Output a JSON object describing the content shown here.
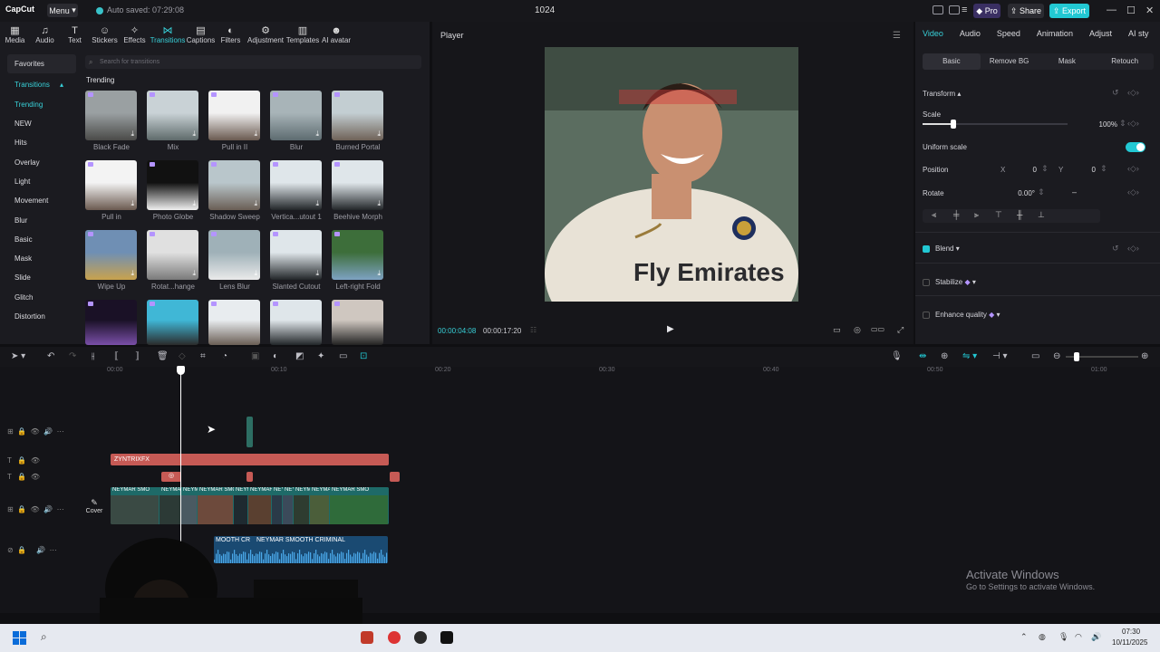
{
  "titlebar": {
    "logo": "CapCut",
    "menu_label": "Menu",
    "autosave": "Auto saved: 07:29:08",
    "project_name": "1024",
    "pro_label": "Pro",
    "share_label": "Share",
    "export_label": "Export",
    "colors": {
      "pro": "#3a2f62",
      "share": "#2b2b31",
      "export": "#22c8d3"
    }
  },
  "toolbar": {
    "tools": [
      {
        "label": "Media",
        "icon": "media-icon"
      },
      {
        "label": "Audio",
        "icon": "audio-icon"
      },
      {
        "label": "Text",
        "icon": "text-icon"
      },
      {
        "label": "Stickers",
        "icon": "stickers-icon"
      },
      {
        "label": "Effects",
        "icon": "effects-icon"
      },
      {
        "label": "Transitions",
        "icon": "transitions-icon",
        "active": true
      },
      {
        "label": "Captions",
        "icon": "captions-icon"
      },
      {
        "label": "Filters",
        "icon": "filters-icon"
      },
      {
        "label": "Adjustment",
        "icon": "adjustment-icon"
      },
      {
        "label": "Templates",
        "icon": "templates-icon"
      },
      {
        "label": "AI avatar",
        "icon": "ai-avatar-icon"
      }
    ]
  },
  "categories": {
    "favorites": "Favorites",
    "transitions_header": "Transitions",
    "items": [
      "Trending",
      "NEW",
      "Hits",
      "Overlay",
      "Light",
      "Movement",
      "Blur",
      "Basic",
      "Mask",
      "Slide",
      "Glitch",
      "Distortion"
    ]
  },
  "search": {
    "placeholder": "Search for transitions"
  },
  "trending": {
    "title": "Trending",
    "items": [
      "Black Fade",
      "Mix",
      "Pull in II",
      "Blur",
      "Burned Portal",
      "Pull in",
      "Photo Globe",
      "Shadow Sweep",
      "Vertica...utout 1",
      "Beehive Morph",
      "Wipe Up",
      "Rotat...hange",
      "Lens Blur",
      "Slanted Cutout",
      "Left-right Fold",
      "",
      "",
      "",
      "",
      ""
    ]
  },
  "player": {
    "title": "Player",
    "time_current": "00:00:04:08",
    "time_total": "00:00:17:20",
    "shirt_text": "Fly Emirates"
  },
  "inspector": {
    "tabs": [
      "Video",
      "Audio",
      "Speed",
      "Animation",
      "Adjust",
      "AI sty"
    ],
    "subtabs": [
      "Basic",
      "Remove BG",
      "Mask",
      "Retouch"
    ],
    "transform_label": "Transform",
    "scale_label": "Scale",
    "scale_value": "100%",
    "scale_level": 0.21,
    "uniform_scale_label": "Uniform scale",
    "position_label": "Position",
    "pos_x_label": "X",
    "pos_x": "0",
    "pos_y_label": "Y",
    "pos_y": "0",
    "rotate_label": "Rotate",
    "rotate_value": "0.00°",
    "blend_label": "Blend",
    "stabilize_label": "Stabilize",
    "enhance_label": "Enhance quality",
    "accent": "#22c8d3"
  },
  "timeline": {
    "ruler": [
      "00:00",
      "00:10",
      "00:20",
      "00:30",
      "00:40",
      "00:50",
      "01:00"
    ],
    "text_clip_label": "ZYNTRIXFX",
    "video_clip_label": "NEYMAR SMO",
    "audio_clip_label": "NEYMAR SMOOTH CRIMINAL",
    "audio_clip_label_short": "MOOTH CR",
    "cover_label": "Cover"
  },
  "watermark": {
    "line1": "Activate Windows",
    "line2": "Go to Settings to activate Windows."
  },
  "taskbar": {
    "time": "07:30",
    "date": "10/11/2025"
  }
}
